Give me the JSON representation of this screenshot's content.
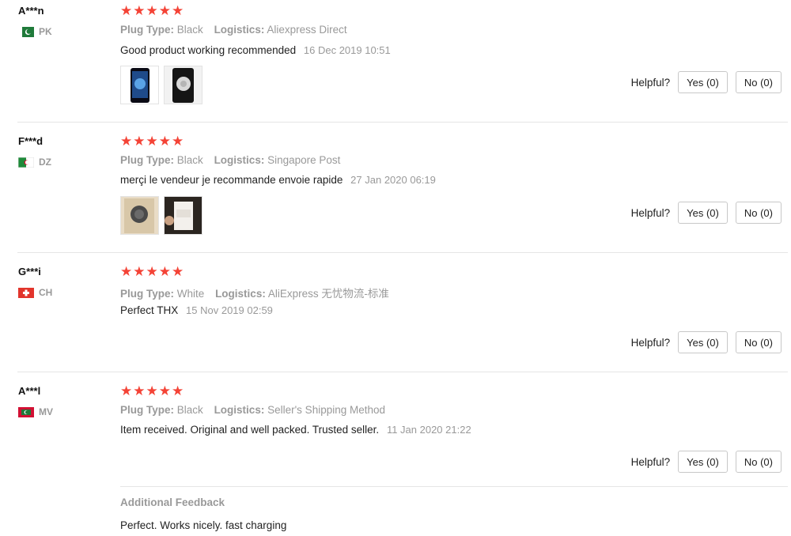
{
  "reviews": [
    {
      "user": "A***n",
      "country": "PK",
      "stars": "★★★★★",
      "plug_label": "Plug Type:",
      "plug_value": "Black",
      "logistics_label": "Logistics:",
      "logistics_value": "Aliexpress Direct",
      "text": "Good product working recommended",
      "date": "16 Dec 2019 10:51",
      "has_photos": true,
      "helpful_label": "Helpful?",
      "yes_label": "Yes (0)",
      "no_label": "No (0)"
    },
    {
      "user": "F***d",
      "country": "DZ",
      "stars": "★★★★★",
      "plug_label": "Plug Type:",
      "plug_value": "Black",
      "logistics_label": "Logistics:",
      "logistics_value": "Singapore Post",
      "text": "merçi le vendeur je recommande envoie rapide",
      "date": "27 Jan 2020 06:19",
      "has_photos": true,
      "helpful_label": "Helpful?",
      "yes_label": "Yes (0)",
      "no_label": "No (0)"
    },
    {
      "user": "G***i",
      "country": "CH",
      "stars": "★★★★★",
      "plug_label": "Plug Type:",
      "plug_value": "White",
      "logistics_label": "Logistics:",
      "logistics_value": "AliExpress 无忧物流-标准",
      "text": "Perfect THX",
      "date": "15 Nov 2019 02:59",
      "has_photos": false,
      "helpful_label": "Helpful?",
      "yes_label": "Yes (0)",
      "no_label": "No (0)"
    },
    {
      "user": "A***l",
      "country": "MV",
      "stars": "★★★★★",
      "plug_label": "Plug Type:",
      "plug_value": "Black",
      "logistics_label": "Logistics:",
      "logistics_value": "Seller's Shipping Method",
      "text": "Item received. Original and well packed. Trusted seller.",
      "date": "11 Jan 2020 21:22",
      "has_photos": false,
      "helpful_label": "Helpful?",
      "yes_label": "Yes (0)",
      "no_label": "No (0)",
      "additional_title": "Additional Feedback",
      "additional_text": "Perfect. Works nicely. fast charging"
    }
  ],
  "colors": {
    "star": "#f44336",
    "muted": "#999999",
    "divider": "#e5e5e5"
  }
}
